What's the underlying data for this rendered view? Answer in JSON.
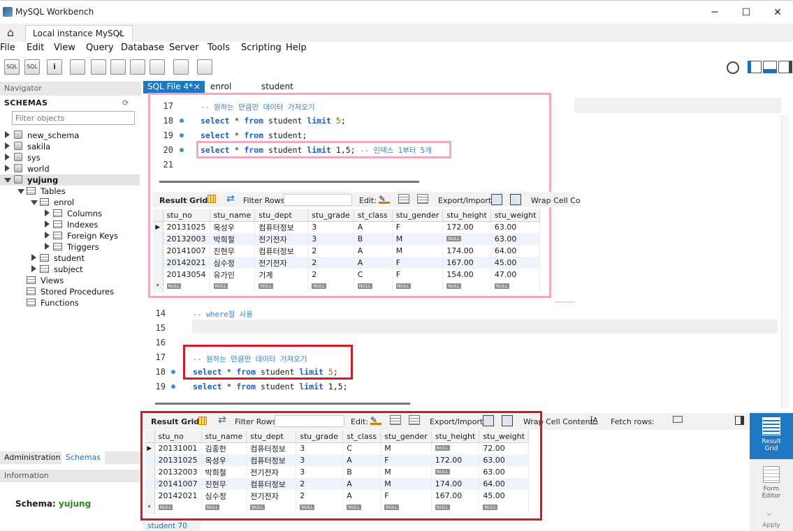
{
  "window": {
    "title": "MySQL Workbench",
    "minimize": "─",
    "maximize": "☐",
    "close": "✕"
  },
  "tabs": {
    "instance_label": "Local instance MySQL",
    "close": "×"
  },
  "menu": [
    "File",
    "Edit",
    "View",
    "Query",
    "Database",
    "Server",
    "Tools",
    "Scripting",
    "Help"
  ],
  "toolbar": [
    "SQL",
    "SQL",
    "i",
    "",
    "",
    "",
    "",
    "",
    "",
    "",
    ""
  ],
  "navigator": {
    "header": "Navigator",
    "schemas_title": "SCHEMAS",
    "filter_placeholder": "Filter objects",
    "schemas": [
      "new_schema",
      "sakila",
      "sys",
      "world",
      "yujung"
    ],
    "tables_label": "Tables",
    "table_enrol": "enrol",
    "enrol_children": [
      "Columns",
      "Indexes",
      "Foreign Keys",
      "Triggers"
    ],
    "table_student": "student",
    "table_subject": "subject",
    "views": "Views",
    "stored_procedures": "Stored Procedures",
    "functions": "Functions"
  },
  "bottom_tabs": {
    "administration": "Administration",
    "schemas": "Schemas"
  },
  "information": {
    "header": "Information",
    "schema_label": "Schema:",
    "schema_value": "yujung"
  },
  "editor_tabs": [
    {
      "label": "SQL File 4*",
      "close": "×"
    },
    {
      "label": "enrol"
    },
    {
      "label": "student"
    }
  ],
  "top_code": {
    "line_numbers": [
      "17",
      "18",
      "19",
      "20",
      "21"
    ],
    "l17_comment": "-- 원하는 만큼만 데이터 가져오기",
    "l18": {
      "kw1": "select",
      "t1": " * ",
      "kw2": "from",
      "t2": " student ",
      "kw3": "limit",
      "num": "5",
      "end": ";"
    },
    "l19": {
      "kw1": "select",
      "t1": " * ",
      "kw2": "from",
      "t2": " student;"
    },
    "l20": {
      "kw1": "select",
      "t1": " * ",
      "kw2": "from",
      "t2": " student ",
      "kw3": "limit",
      "t3": " 1,5; ",
      "comment": "-- 인덱스 1부터 5개"
    }
  },
  "grid_toolbar": {
    "result_grid": "Result Grid",
    "filter_rows": "Filter Rows:",
    "edit": "Edit:",
    "export_import": "Export/Import:",
    "wrap": "Wrap Cell Content:",
    "wrap_short": "Wrap Cell Co",
    "fetch_rows": "Fetch rows:"
  },
  "columns": [
    "stu_no",
    "stu_name",
    "stu_dept",
    "stu_grade",
    "st_class",
    "stu_gender",
    "stu_height",
    "stu_weight"
  ],
  "null_label": "NULL",
  "grid1_rows": [
    [
      "20131025",
      "옥성우",
      "컴퓨터정보",
      "3",
      "A",
      "F",
      "172.00",
      "63.00"
    ],
    [
      "20132003",
      "박희철",
      "전기전자",
      "3",
      "B",
      "M",
      "NULL",
      "63.00"
    ],
    [
      "20141007",
      "진현무",
      "컴퓨터정보",
      "2",
      "A",
      "M",
      "174.00",
      "64.00"
    ],
    [
      "20142021",
      "심수정",
      "전기전자",
      "2",
      "A",
      "F",
      "167.00",
      "45.00"
    ],
    [
      "20143054",
      "유가인",
      "기계",
      "2",
      "C",
      "F",
      "154.00",
      "47.00"
    ]
  ],
  "mid_code": {
    "line_numbers": [
      "14",
      "15",
      "16",
      "17",
      "18",
      "19"
    ],
    "l14_comment": "-- where절 사용",
    "l17_comment": "-- 원하는 만큼만 데이터 가져오기",
    "l18": {
      "kw1": "select",
      "t1": " * ",
      "kw2": "from",
      "t2": " student ",
      "kw3": "limit",
      "num": "5",
      "end": ";"
    },
    "l19": {
      "kw1": "select",
      "t1": " * ",
      "kw2": "from",
      "t2": " student ",
      "kw3": "limit",
      "t3": " 1,5;"
    }
  },
  "grid2_rows": [
    [
      "20131001",
      "김종헌",
      "컴퓨터정보",
      "3",
      "C",
      "M",
      "NULL",
      "72.00"
    ],
    [
      "20131025",
      "옥성우",
      "컴퓨터정보",
      "3",
      "A",
      "F",
      "172.00",
      "63.00"
    ],
    [
      "20132003",
      "박희철",
      "전기전자",
      "3",
      "B",
      "M",
      "NULL",
      "63.00"
    ],
    [
      "20141007",
      "진현무",
      "컴퓨터정보",
      "2",
      "A",
      "M",
      "174.00",
      "64.00"
    ],
    [
      "20142021",
      "심수정",
      "전기전자",
      "2",
      "A",
      "F",
      "167.00",
      "45.00"
    ]
  ],
  "side_panel": {
    "result_grid_l1": "Result",
    "result_grid_l2": "Grid",
    "form_editor_l1": "Form",
    "form_editor_l2": "Editor",
    "apply": "Apply"
  },
  "bottom_tab": "student 70",
  "colors": {
    "pink_highlight": "#f4a7c4",
    "red_highlight": "#d31b27",
    "accent_blue": "#1f78c1",
    "schema_green": "#2a8a1e"
  }
}
